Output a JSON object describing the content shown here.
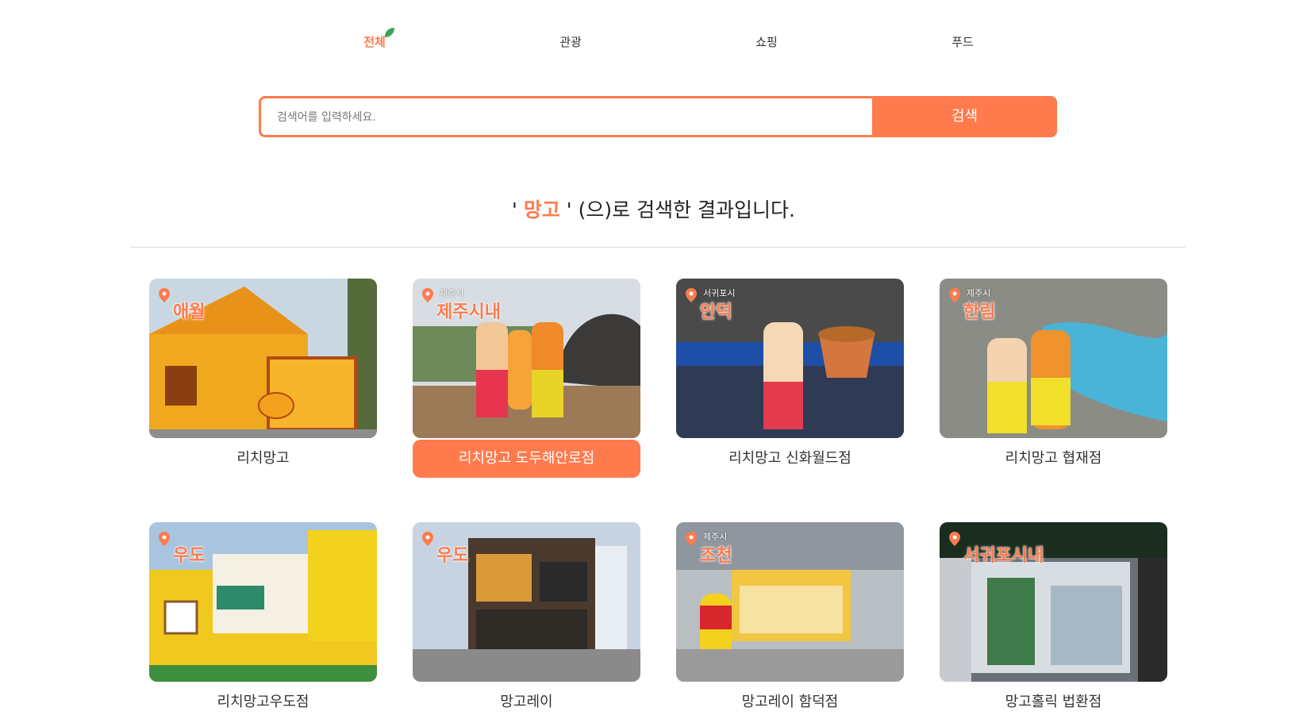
{
  "tabs": [
    {
      "label": "전체",
      "active": true
    },
    {
      "label": "관광",
      "active": false
    },
    {
      "label": "쇼핑",
      "active": false
    },
    {
      "label": "푸드",
      "active": false
    }
  ],
  "search": {
    "placeholder": "검색어를 입력하세요.",
    "value": "",
    "button_label": "검색"
  },
  "result": {
    "prefix": "' ",
    "keyword": "망고",
    "suffix": " ' (으)로 검색한 결과입니다."
  },
  "colors": {
    "accent": "#ff7a4d",
    "leaf": "#3aa655"
  },
  "icons": {
    "region_marker": "map-pin-icon",
    "tab_decoration": "leaf-icon"
  },
  "cards": [
    {
      "region_sub": "",
      "region": "애월",
      "title": "리치망고",
      "highlight": false
    },
    {
      "region_sub": "제주시",
      "region": "제주시내",
      "title": "리치망고 도두해안로점",
      "highlight": true
    },
    {
      "region_sub": "서귀포시",
      "region": "안덕",
      "title": "리치망고 신화월드점",
      "highlight": false
    },
    {
      "region_sub": "제주시",
      "region": "한림",
      "title": "리치망고 협재점",
      "highlight": false
    },
    {
      "region_sub": "",
      "region": "우도",
      "title": "리치망고우도점",
      "highlight": false
    },
    {
      "region_sub": "",
      "region": "우도",
      "title": "망고레이",
      "highlight": false
    },
    {
      "region_sub": "제주시",
      "region": "조천",
      "title": "망고레이 함덕점",
      "highlight": false
    },
    {
      "region_sub": "",
      "region": "서귀포시내",
      "title": "망고홀릭 법환점",
      "highlight": false
    }
  ]
}
